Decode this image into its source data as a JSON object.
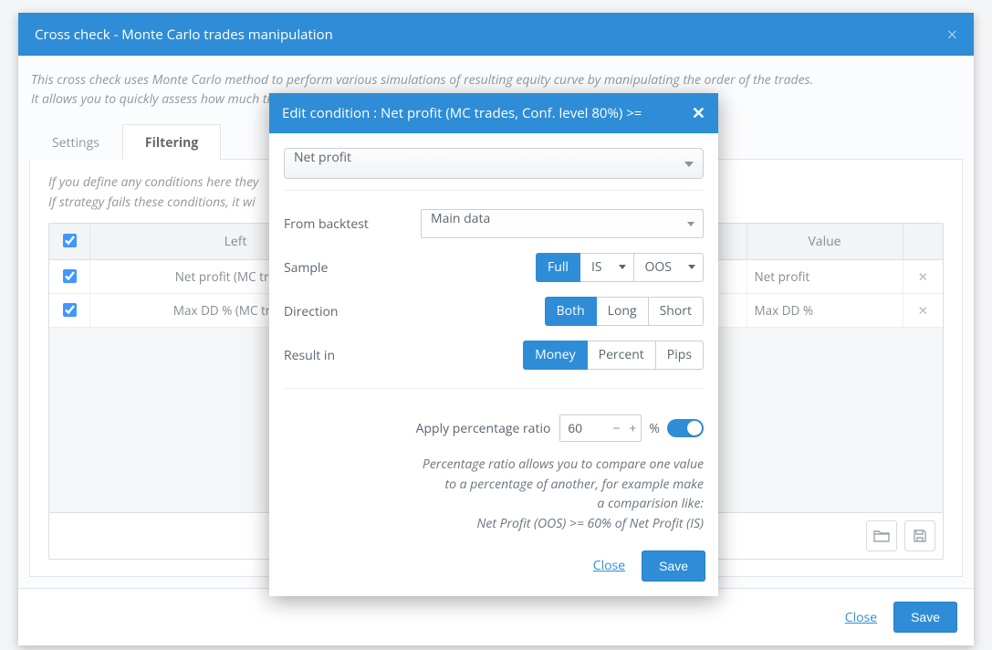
{
  "outer": {
    "title": "Cross check - Monte Carlo trades manipulation",
    "desc1": "This cross check uses Monte Carlo method to perform various simulations of resulting equity curve by manipulating the order of the trades.",
    "desc2": "It allows you to quickly assess how much the good results are dependent on order of the trades.",
    "tabs": {
      "settings": "Settings",
      "filtering": "Filtering"
    },
    "hint1": "If you define any conditions here they",
    "hint2": "If strategy fails these conditions, it wi",
    "table": {
      "head": {
        "left": "Left",
        "value": "Value"
      },
      "rows": [
        {
          "left": "Net profit (MC trades",
          "value": "Net profit"
        },
        {
          "left": "Max DD % (MC trades",
          "value": "Max DD %"
        }
      ]
    },
    "footer": {
      "close": "Close",
      "save": "Save"
    }
  },
  "modal": {
    "title": "Edit condition : Net profit (MC trades, Conf. level 80%) >=",
    "main_select": "Net profit",
    "rows": {
      "from_backtest": {
        "label": "From backtest",
        "value": "Main data"
      },
      "sample": {
        "label": "Sample",
        "options": [
          "Full",
          "IS",
          "OOS"
        ],
        "selected": "Full"
      },
      "direction": {
        "label": "Direction",
        "options": [
          "Both",
          "Long",
          "Short"
        ],
        "selected": "Both"
      },
      "result_in": {
        "label": "Result in",
        "options": [
          "Money",
          "Percent",
          "Pips"
        ],
        "selected": "Money"
      },
      "apply_ratio": {
        "label": "Apply percentage ratio",
        "value": "60",
        "suffix": "%"
      }
    },
    "help": {
      "l1": "Percentage ratio allows you to compare one value",
      "l2": "to a percentage of another, for example make",
      "l3": "a comparision like:",
      "l4": "Net Profit (OOS) >= 60% of Net Profit (IS)"
    },
    "footer": {
      "close": "Close",
      "save": "Save"
    }
  }
}
